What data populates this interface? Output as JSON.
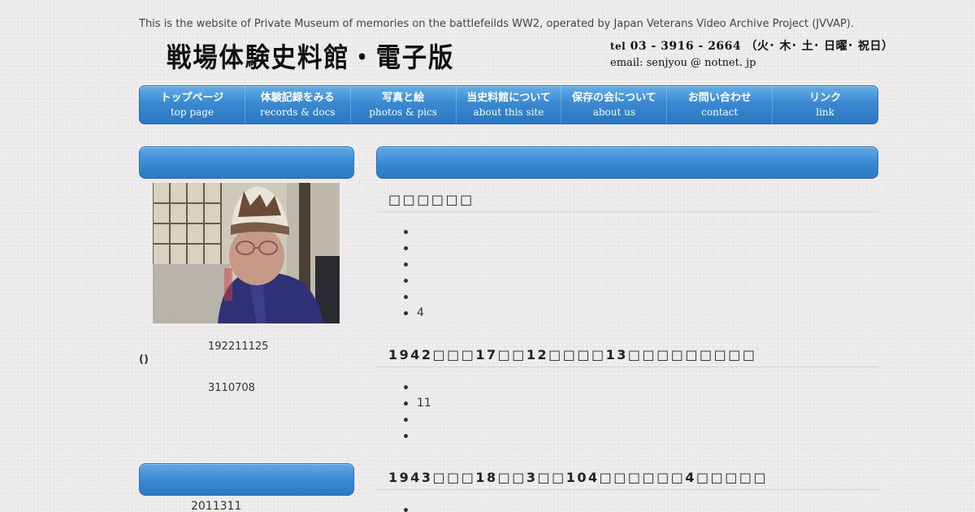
{
  "intro_text": "This is the website of Private Museum of memories on the battlefeilds WW2, operated by Japan Veterans Video Archive Project (JVVAP).",
  "logo_text": "戦場体験史料館・電子版",
  "contact": {
    "tel_label": "tel",
    "tel": "03 - 3916 - 2664",
    "days": "（火･ 木･ 土･ 日曜･ 祝日）",
    "email": "email:  senjyou @ notnet. jp"
  },
  "nav": [
    {
      "jp": "トップページ",
      "en": "top page"
    },
    {
      "jp": "体験記録をみる",
      "en": "records & docs"
    },
    {
      "jp": "写真と絵",
      "en": "photos & pics"
    },
    {
      "jp": "当史料館について",
      "en": "about this site"
    },
    {
      "jp": "保存の会について",
      "en": "about us"
    },
    {
      "jp": "お問い合わせ",
      "en": "contact"
    },
    {
      "jp": "リンク",
      "en": "link"
    }
  ],
  "sidebar": {
    "line1": "192211125",
    "line2": "()",
    "line3": "3110708",
    "line4": "2011311"
  },
  "sections": [
    {
      "heading": "□□□□□□",
      "items": [
        "",
        "",
        "",
        "",
        "",
        "4"
      ]
    },
    {
      "heading": "1942□□□17□□12□□□□13□□□□□□□□□",
      "items": [
        "",
        "11",
        "",
        ""
      ]
    },
    {
      "heading": "1943□□□18□□3□□104□□□□□□4□□□□□",
      "items": [
        ""
      ]
    }
  ],
  "colors": {
    "nav_blue": "#3a89d2",
    "bar_blue": "#3b8bd4",
    "background": "#eceaea"
  }
}
